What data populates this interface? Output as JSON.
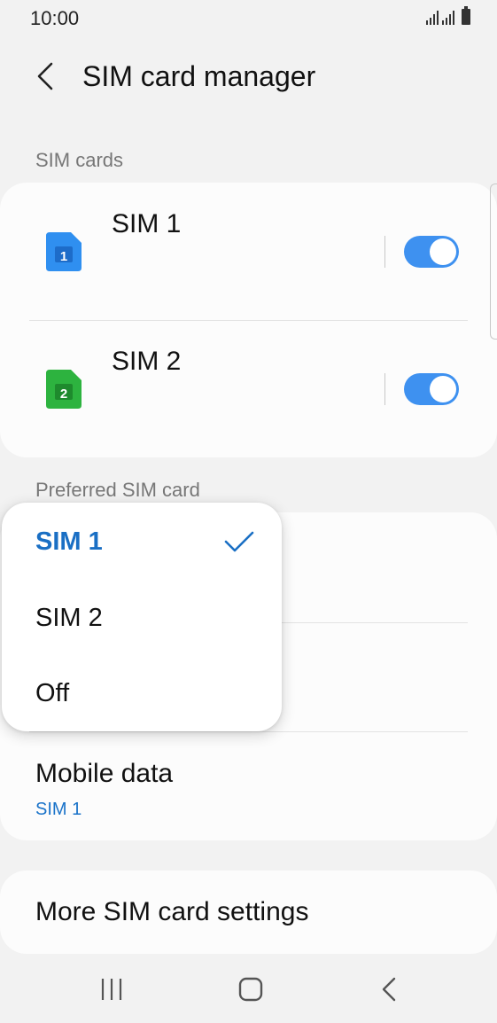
{
  "status_bar": {
    "time": "10:00"
  },
  "header": {
    "title": "SIM card manager"
  },
  "sim_cards": {
    "section_label": "SIM cards",
    "items": [
      {
        "label": "SIM 1",
        "icon": "sim-1-icon",
        "icon_number": "1",
        "icon_color": "#2f8ff0",
        "enabled": true
      },
      {
        "label": "SIM 2",
        "icon": "sim-2-icon",
        "icon_number": "2",
        "icon_color": "#2db33f",
        "enabled": true
      }
    ],
    "toggle_color": "#3e91f0"
  },
  "preferred": {
    "section_label": "Preferred SIM card",
    "mobile_data": {
      "title": "Mobile data",
      "value": "SIM 1"
    }
  },
  "dropdown": {
    "options": [
      {
        "label": "SIM 1",
        "selected": true
      },
      {
        "label": "SIM 2",
        "selected": false
      },
      {
        "label": "Off",
        "selected": false
      }
    ],
    "accent_color": "#1a6fc4"
  },
  "more": {
    "title": "More SIM card settings"
  },
  "nav": {
    "recents": "recents-icon",
    "home": "home-icon",
    "back": "back-icon"
  }
}
